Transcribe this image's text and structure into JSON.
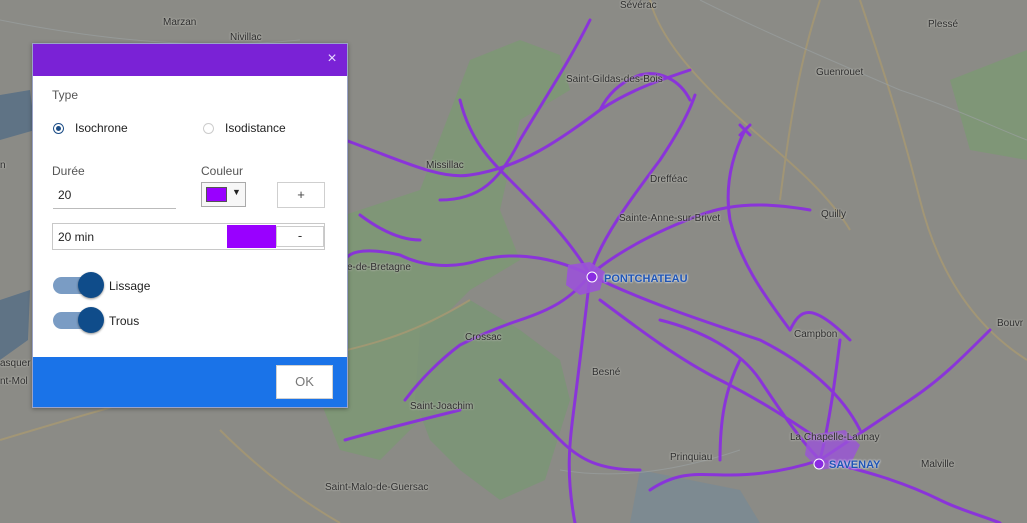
{
  "colors": {
    "accent": "#7a22d6",
    "footer": "#1a73e8",
    "isochrone": "#9900ff",
    "roads": "#8a2be2"
  },
  "map": {
    "places": [
      {
        "id": "marzan",
        "name": "Marzan"
      },
      {
        "id": "nivillac",
        "name": "Nivillac"
      },
      {
        "id": "severac",
        "name": "Sévérac"
      },
      {
        "id": "plesse",
        "name": "Plessé"
      },
      {
        "id": "guenrouet",
        "name": "Guenrouet"
      },
      {
        "id": "stgildas",
        "name": "Saint-Gildas-des-Bois"
      },
      {
        "id": "missillac",
        "name": "Missillac"
      },
      {
        "id": "drefféac",
        "name": "Drefféac"
      },
      {
        "id": "steanne",
        "name": "Sainte-Anne-sur-Brivet"
      },
      {
        "id": "quilly",
        "name": "Quilly"
      },
      {
        "id": "bretagne",
        "name": "e-de-Bretagne"
      },
      {
        "id": "crossac",
        "name": "Crossac"
      },
      {
        "id": "campbon",
        "name": "Campbon"
      },
      {
        "id": "bouvron",
        "name": "Bouvr"
      },
      {
        "id": "besne",
        "name": "Besné"
      },
      {
        "id": "stjoachim",
        "name": "Saint-Joachim"
      },
      {
        "id": "lachapelle",
        "name": "La Chapelle-Launay"
      },
      {
        "id": "prinquiau",
        "name": "Prinquiau"
      },
      {
        "id": "malville",
        "name": "Malville"
      },
      {
        "id": "stmalo",
        "name": "Saint-Malo-de-Guersac"
      },
      {
        "id": "asquer",
        "name": "asquer"
      },
      {
        "id": "ntmoi",
        "name": "nt-Mol"
      },
      {
        "id": "n",
        "name": "n"
      }
    ],
    "cities": [
      {
        "id": "pontchateau",
        "name": "PONTCHATEAU"
      },
      {
        "id": "savenay",
        "name": "SAVENAY"
      }
    ]
  },
  "dialog": {
    "close_icon": "×",
    "type_label": "Type",
    "radio_isochrone": "Isochrone",
    "radio_isodistance": "Isodistance",
    "duration_label": "Durée",
    "duration_value": "20",
    "color_label": "Couleur",
    "color_caret": "▼",
    "add_label": "+",
    "entry": {
      "label": "20 min",
      "remove_label": "-"
    },
    "toggle_lissage": "Lissage",
    "toggle_trous": "Trous",
    "ok_label": "OK"
  }
}
